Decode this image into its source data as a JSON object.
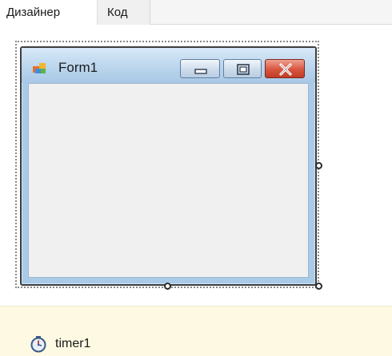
{
  "tabs": [
    {
      "label": "Дизайнер",
      "active": true
    },
    {
      "label": "Код",
      "active": false
    }
  ],
  "form": {
    "title": "Form1",
    "icon": "form-app-icon",
    "buttons": [
      "minimize-icon",
      "maximize-icon",
      "close-icon"
    ]
  },
  "component_tray": {
    "items": [
      {
        "label": "timer1",
        "icon": "timer-icon"
      }
    ]
  },
  "colors": {
    "tray_background": "#fdf9e2",
    "close_button": "#d8553f",
    "title_bar": "#b9d4ec",
    "client_area": "#f0f0f0"
  }
}
